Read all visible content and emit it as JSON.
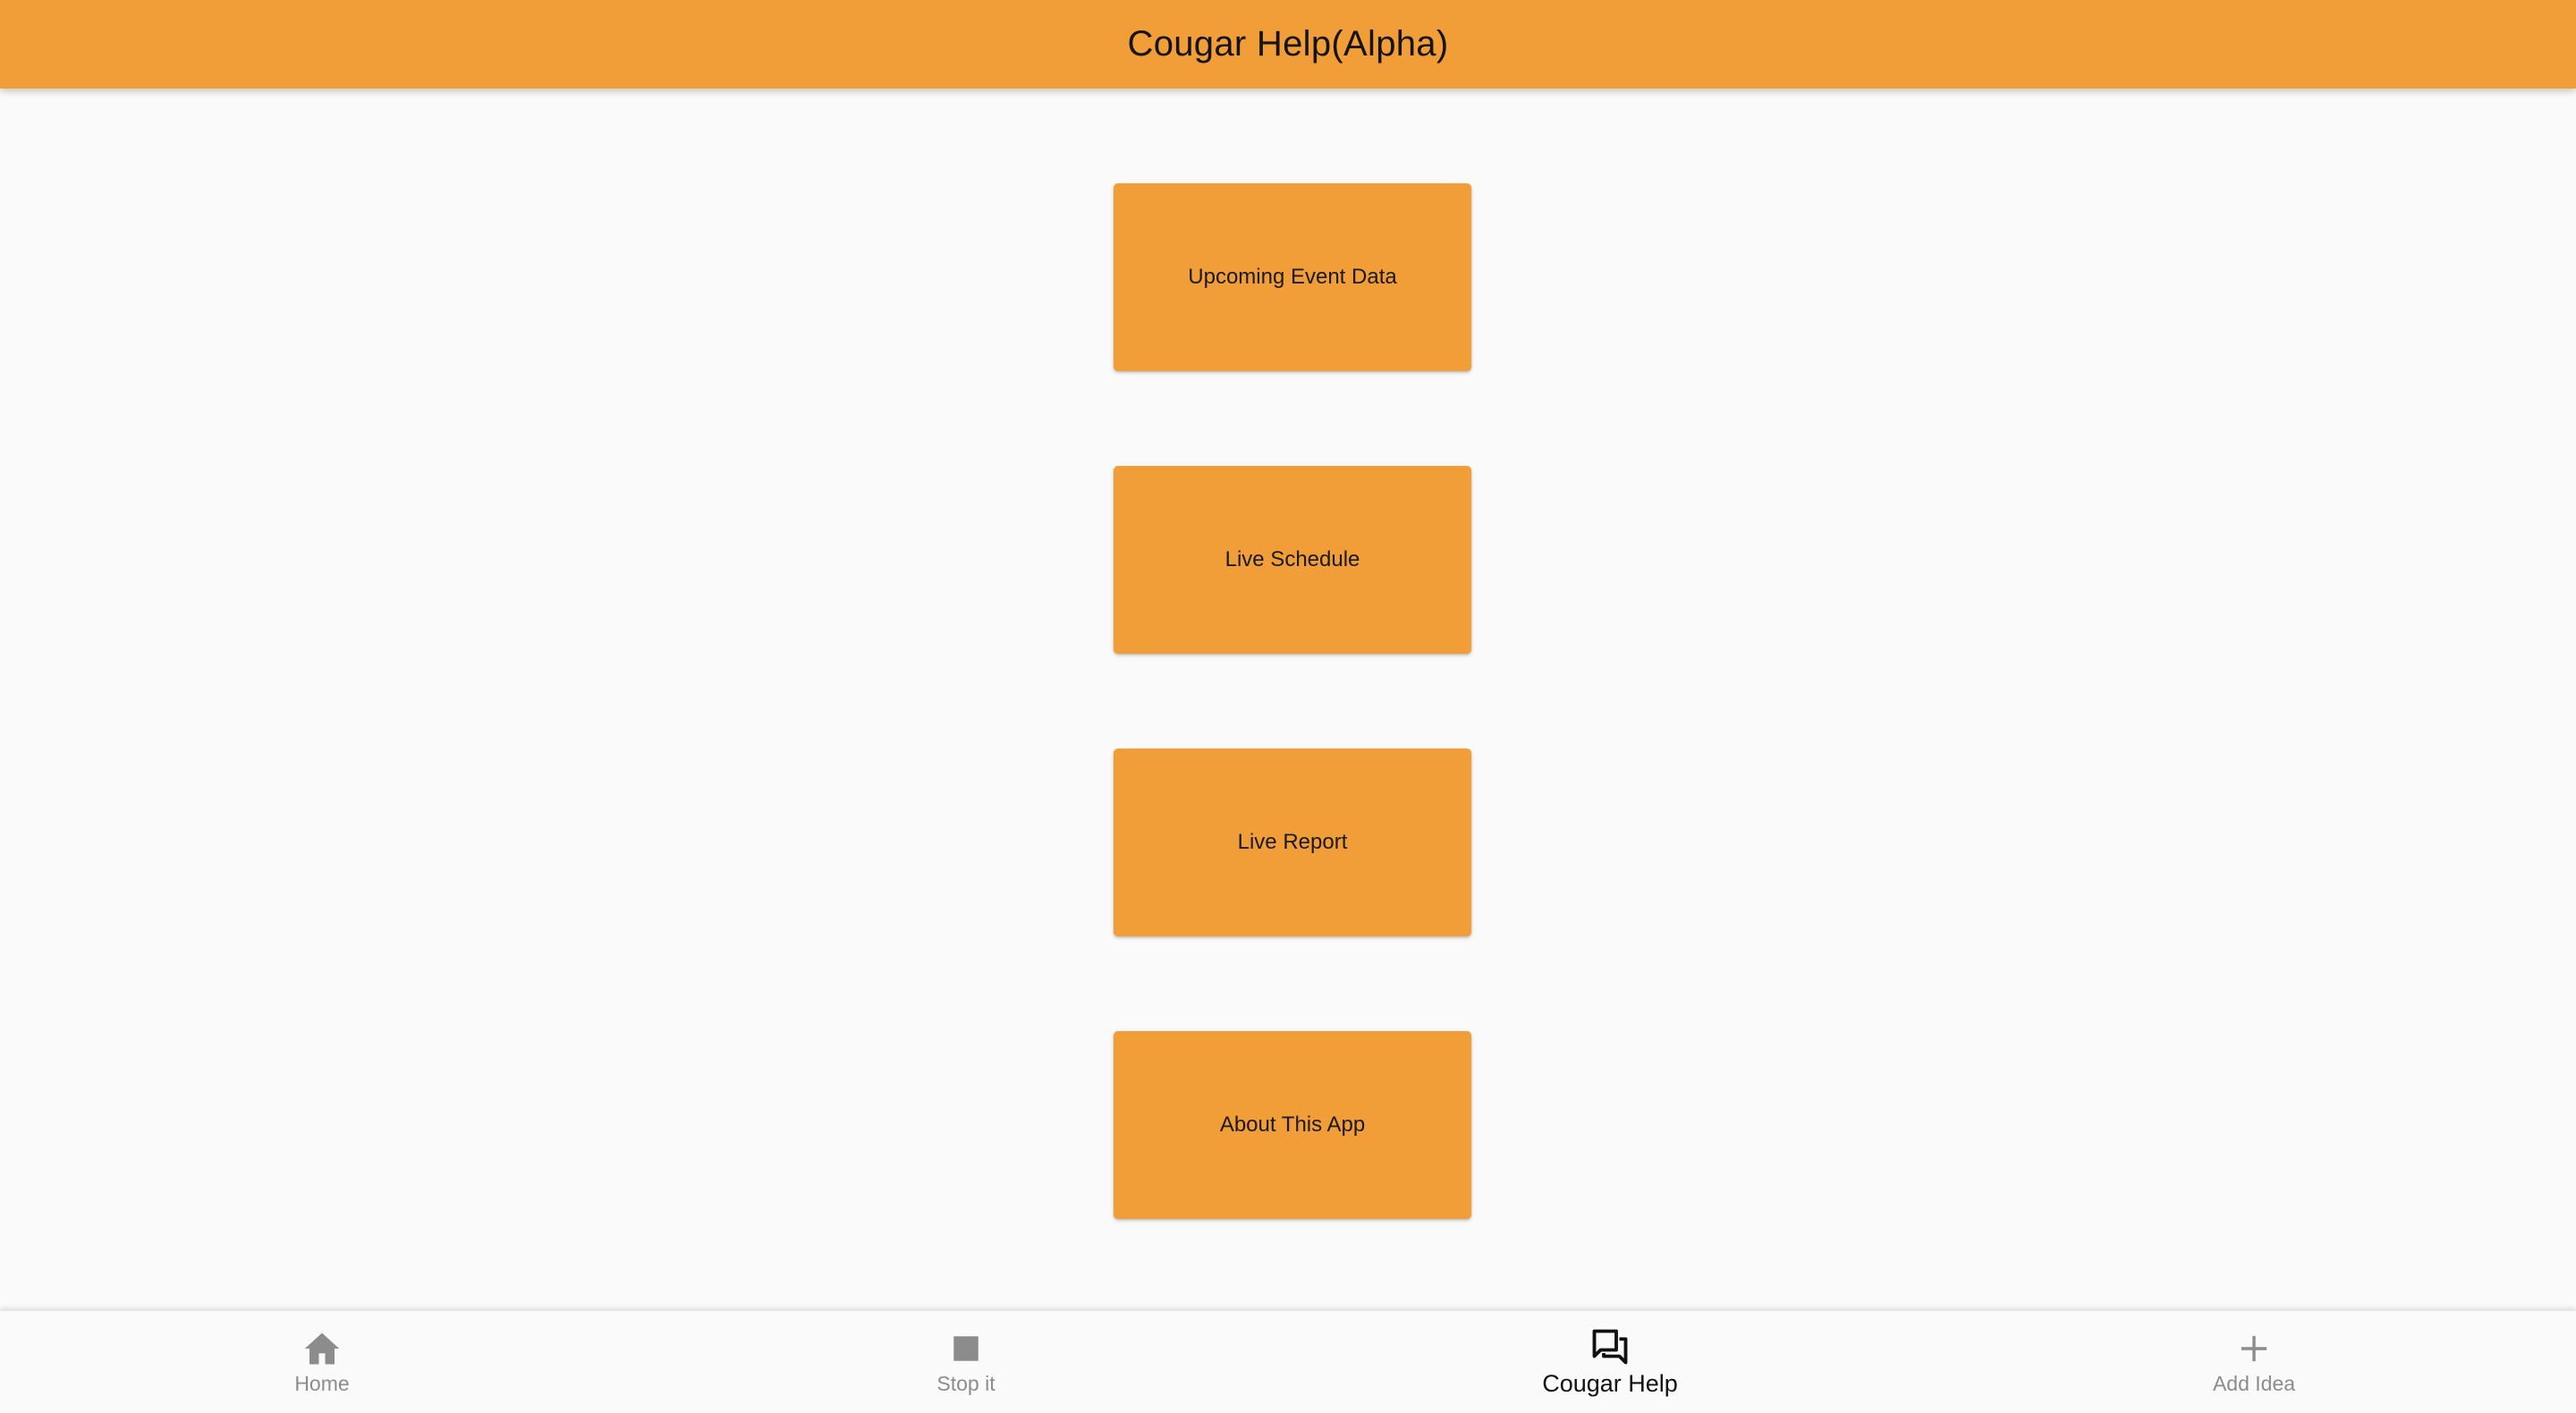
{
  "app_bar": {
    "title": "Cougar Help(Alpha)"
  },
  "menu": {
    "buttons": [
      {
        "label": "Upcoming Event Data"
      },
      {
        "label": "Live Schedule"
      },
      {
        "label": "Live Report"
      },
      {
        "label": "About This App"
      }
    ]
  },
  "bottom_nav": {
    "items": [
      {
        "label": "Home",
        "icon": "home-icon",
        "active": false
      },
      {
        "label": "Stop it",
        "icon": "stop-icon",
        "active": false
      },
      {
        "label": "Cougar Help",
        "icon": "forum-icon",
        "active": true
      },
      {
        "label": "Add Idea",
        "icon": "add-icon",
        "active": false
      }
    ]
  },
  "colors": {
    "primary": "#f19d38",
    "background": "#fafafa",
    "inactive_nav": "#8c8c8c",
    "active_nav": "#111111"
  }
}
